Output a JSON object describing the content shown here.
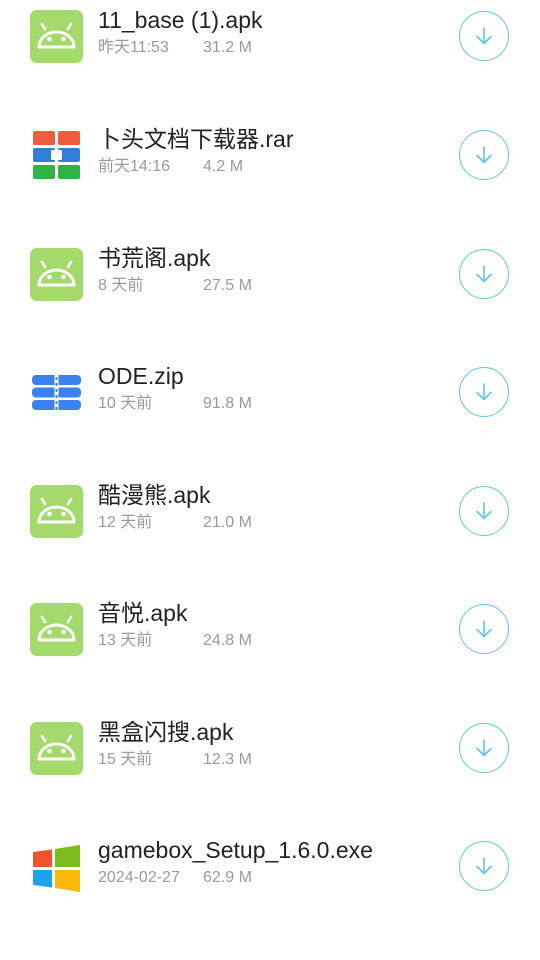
{
  "accent_color": "#5cc8ea",
  "files": [
    {
      "name": "11_base (1).apk",
      "date": "昨天11:53",
      "size": "31.2 M",
      "icon": "android-icon"
    },
    {
      "name": "卜头文档下载器.rar",
      "date": "前天14:16",
      "size": "4.2 M",
      "icon": "archive-icon"
    },
    {
      "name": "书荒阁.apk",
      "date": "8 天前",
      "size": "27.5 M",
      "icon": "android-icon"
    },
    {
      "name": "ODE.zip",
      "date": "10 天前",
      "size": "91.8 M",
      "icon": "zip-icon"
    },
    {
      "name": "酷漫熊.apk",
      "date": "12 天前",
      "size": "21.0 M",
      "icon": "android-icon"
    },
    {
      "name": "音悦.apk",
      "date": "13 天前",
      "size": "24.8 M",
      "icon": "android-icon"
    },
    {
      "name": "黑盒闪搜.apk",
      "date": "15 天前",
      "size": "12.3 M",
      "icon": "android-icon"
    },
    {
      "name": "gamebox_Setup_1.6.0.exe",
      "date": "2024-02-27",
      "size": "62.9 M",
      "icon": "windows-icon"
    }
  ]
}
